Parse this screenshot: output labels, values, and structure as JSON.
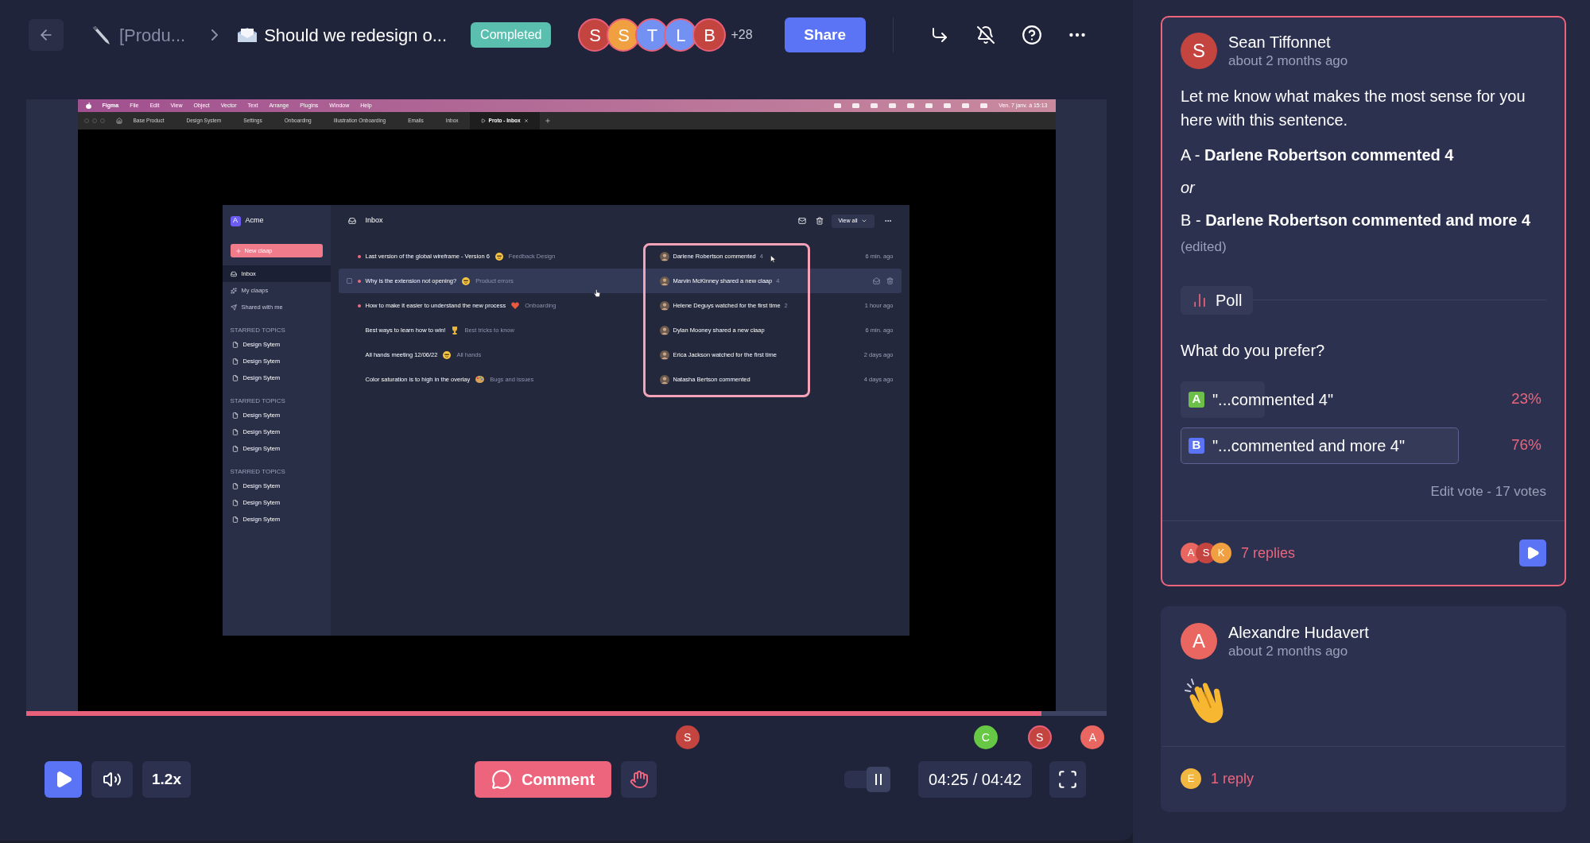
{
  "topbar": {
    "crumbs": [
      "[Produ...",
      "Should we redesign o..."
    ],
    "status": "Completed",
    "participants": [
      {
        "initial": "S",
        "color": "#c44440"
      },
      {
        "initial": "S",
        "color": "#f0a040"
      },
      {
        "initial": "T",
        "color": "#7391f2"
      },
      {
        "initial": "L",
        "color": "#7391f2"
      },
      {
        "initial": "B",
        "color": "#c44440"
      }
    ],
    "more": "+28",
    "share": "Share"
  },
  "video": {
    "menubar": {
      "app": "Figma",
      "menus": [
        "File",
        "Edit",
        "View",
        "Object",
        "Vector",
        "Text",
        "Arrange",
        "Plugins",
        "Window",
        "Help"
      ],
      "clock": "Ven. 7 janv. à 15:13"
    },
    "tabs": [
      {
        "label": "Base Product",
        "selected": false
      },
      {
        "label": "Design System",
        "selected": false
      },
      {
        "label": "Settings",
        "selected": false
      },
      {
        "label": "Onboarding",
        "selected": false
      },
      {
        "label": "Illustration Onboarding",
        "selected": false
      },
      {
        "label": "Emails",
        "selected": false
      },
      {
        "label": "Inbox",
        "selected": false
      },
      {
        "label": "Proto - Inbox",
        "selected": true
      }
    ],
    "app": {
      "workspace": {
        "initial": "A",
        "name": "Acme"
      },
      "new_button": "New claap",
      "nav": [
        {
          "label": "Inbox",
          "selected": true
        },
        {
          "label": "My claaps",
          "selected": false
        },
        {
          "label": "Shared with me",
          "selected": false
        }
      ],
      "sections": [
        {
          "title": "STARRED TOPICS",
          "items": [
            "Design Sytem",
            "Design Sytem",
            "Design Sytem"
          ]
        },
        {
          "title": "STARRED TOPICS",
          "items": [
            "Design Sytem",
            "Design Sytem",
            "Design Sytem"
          ]
        },
        {
          "title": "STARRED TOPICS",
          "items": [
            "Design Sytem",
            "Design Sytem",
            "Design Sytem"
          ]
        }
      ],
      "title": "Inbox",
      "view_all": "View all",
      "rows": [
        {
          "title": "Last version of the global wireframe - Version 6",
          "unread": true,
          "topic": "Feedback Design",
          "activity": "Darlene Robertson commented",
          "count": "4",
          "time": "6 min. ago",
          "hovered": false
        },
        {
          "title": "Why is the extension not opening?",
          "unread": true,
          "topic": "Product errors",
          "activity": "Marvin McKinney shared a new claap",
          "count": "4",
          "hovered": true
        },
        {
          "title": "How to make it easier to understand the new process",
          "unread": true,
          "topic": "Onboarding",
          "activity": "Helene Deguys watched for the first time",
          "count": "2",
          "time": "1 hour ago",
          "hovered": false
        },
        {
          "title": "Best ways to learn how to win!",
          "unread": false,
          "topic": "Best tricks to know",
          "activity": "Dylan Mooney shared a new claap",
          "time": "6 min. ago",
          "hovered": false
        },
        {
          "title": "All hands meeting 12/06/22",
          "unread": false,
          "topic": "All hands",
          "activity": "Erica Jackson watched for the first time",
          "time": "2 days ago",
          "hovered": false
        },
        {
          "title": "Color saturation is to high in the overlay",
          "unread": false,
          "topic": "Bugs and issues",
          "activity": "Natasha Bertson commented",
          "time": "4 days ago",
          "hovered": false
        }
      ]
    }
  },
  "timeline": {
    "level": 0.94,
    "markers": [
      {
        "initial": "S",
        "color": "#c44440",
        "selected": false
      },
      {
        "initial": "C",
        "color": "#66c844",
        "selected": false
      },
      {
        "initial": "S",
        "color": "#c44440",
        "selected": true
      },
      {
        "initial": "A",
        "color": "#ea6660",
        "selected": false
      }
    ]
  },
  "controls": {
    "speed": "1.2x",
    "comment": "Comment",
    "toggle_on": true,
    "time": "04:25 / 04:42"
  },
  "comments": [
    {
      "selected": true,
      "author": "Sean Tiffonnet",
      "initial": "S",
      "color": "#c44440",
      "time": "about 2 months ago",
      "body": [
        {
          "kind": "text",
          "text": "Let me know what makes the most sense for you here with this sentence."
        },
        {
          "kind": "text",
          "text": "A - **Darlene Robertson commented 4**"
        },
        {
          "kind": "aside",
          "text": "or"
        },
        {
          "kind": "text",
          "text": "B - **Darlene Robertson commented and more 4**"
        },
        {
          "kind": "note",
          "text": "(edited)"
        }
      ],
      "poll": {
        "label": "Poll",
        "question": "What do you prefer?",
        "options": [
          {
            "letter": "A",
            "color": "#6cc04a",
            "text": "\"...commented 4\"",
            "percent": "23%",
            "level": 0.23,
            "selected": false
          },
          {
            "letter": "B",
            "color": "#5b73f5",
            "text": "\"...commented and more 4\"",
            "percent": "76%",
            "level": 0.76,
            "selected": true
          }
        ],
        "footer": "Edit vote - 17 votes"
      },
      "repliers": [
        {
          "initial": "A",
          "color": "#ea6660"
        },
        {
          "initial": "S",
          "color": "#c44440"
        },
        {
          "initial": "K",
          "color": "#f0a040"
        }
      ],
      "replies": "7 replies",
      "play": true
    },
    {
      "selected": false,
      "author": "Alexandre Hudavert",
      "initial": "A",
      "color": "#ea6660",
      "time": "about 2 months ago",
      "body": [
        {
          "kind": "clap"
        }
      ],
      "repliers": [
        {
          "initial": "E",
          "color": "#f2b740"
        }
      ],
      "replies": "1 reply",
      "play": false
    }
  ]
}
